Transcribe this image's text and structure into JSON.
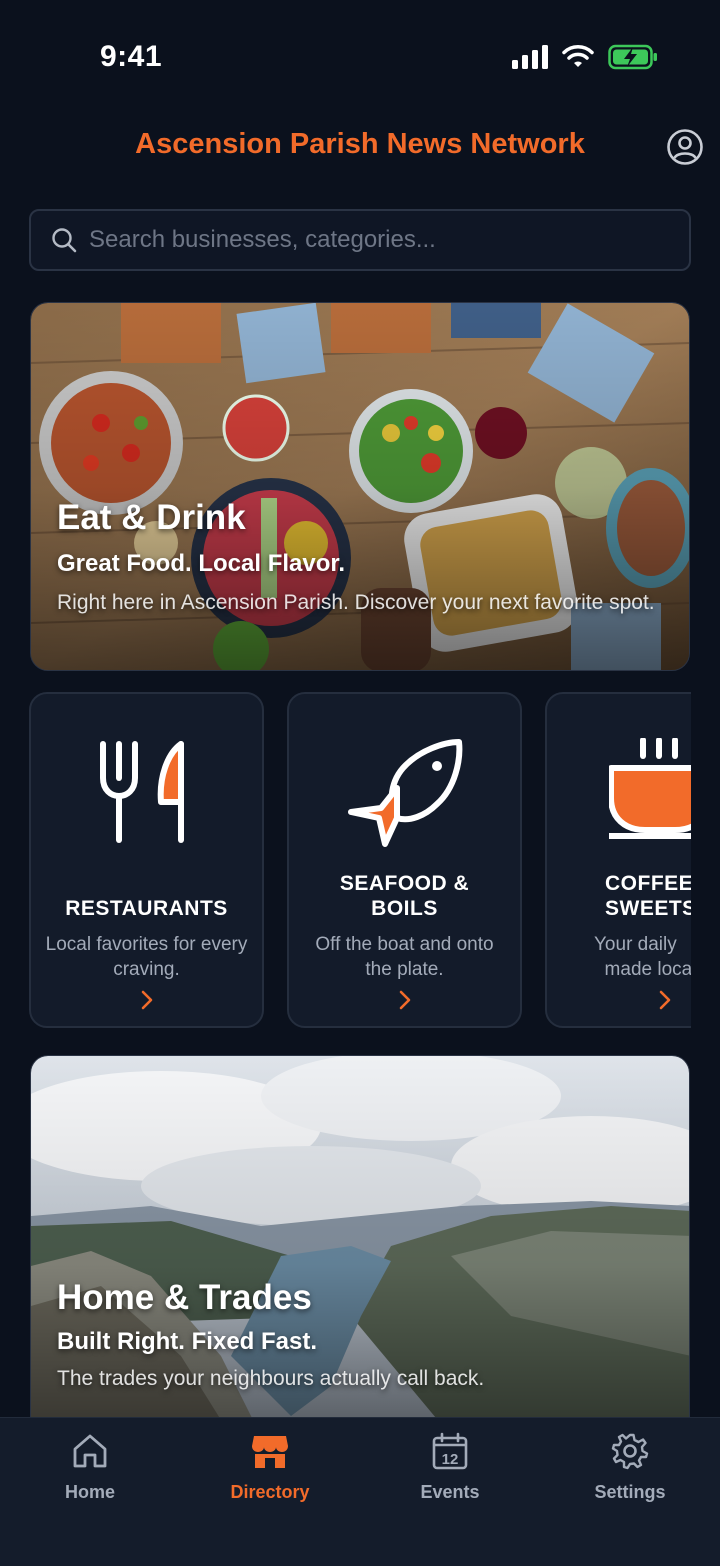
{
  "status": {
    "time": "9:41"
  },
  "header": {
    "title": "Ascension Parish News Network"
  },
  "search": {
    "placeholder": "Search businesses, categories..."
  },
  "hero_food": {
    "title": "Eat & Drink",
    "subtitle": "Great Food. Local Flavor.",
    "description": "Right here in Ascension Parish. Discover your next favorite spot."
  },
  "categories": [
    {
      "title": "RESTAURANTS",
      "description": "Local favorites for every craving.",
      "icon": "fork-knife-icon"
    },
    {
      "title": "SEAFOOD & BOILS",
      "description": "Off the boat and onto the plate.",
      "icon": "fish-icon"
    },
    {
      "title": "COFFEE & SWEETS",
      "description": "Your daily made local.",
      "icon": "coffee-cup-icon"
    }
  ],
  "hero_trades": {
    "title": "Home & Trades",
    "subtitle": "Built Right. Fixed Fast.",
    "description": "The trades your neighbours actually call back."
  },
  "tabs": [
    {
      "label": "Home",
      "icon": "home-icon",
      "active": false
    },
    {
      "label": "Directory",
      "icon": "storefront-icon",
      "active": true
    },
    {
      "label": "Events",
      "icon": "calendar-icon",
      "active": false
    },
    {
      "label": "Settings",
      "icon": "gear-icon",
      "active": false
    }
  ],
  "calendar_day": "12",
  "colors": {
    "accent": "#f26b2a",
    "background": "#0b111d",
    "card": "#131b2a"
  }
}
